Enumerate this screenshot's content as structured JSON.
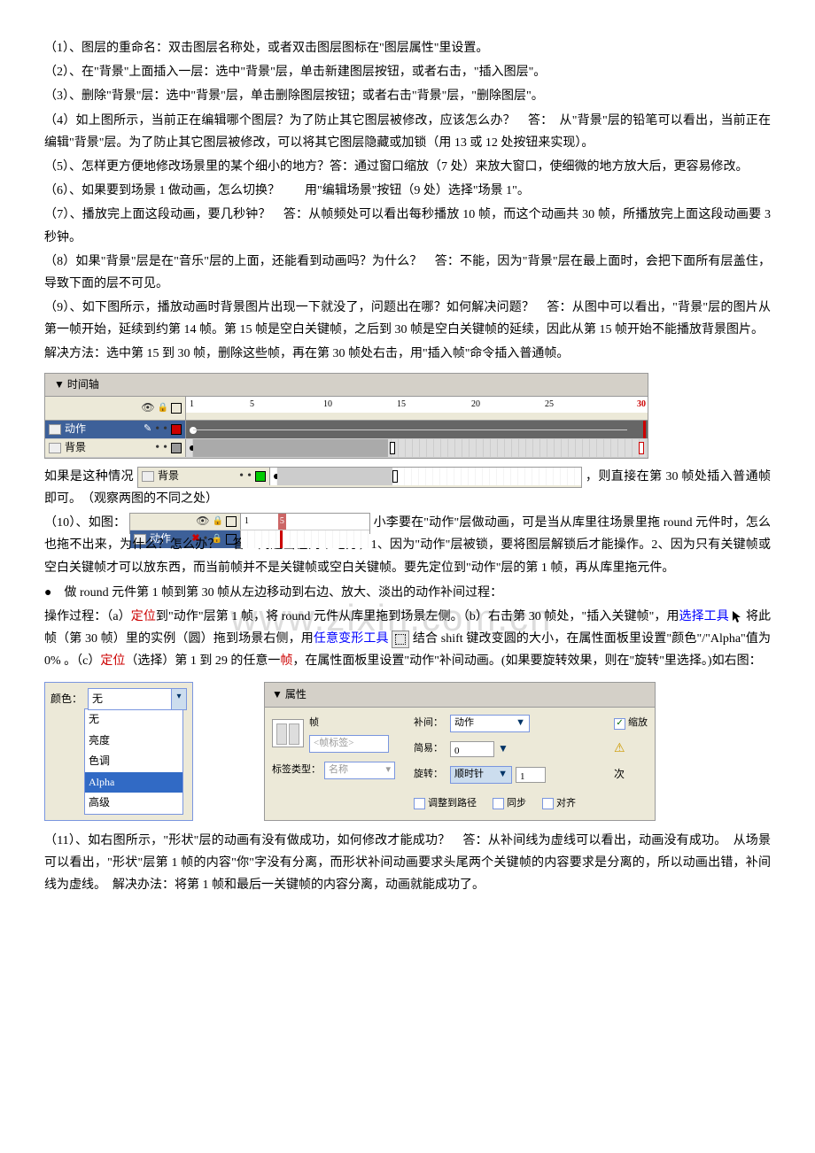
{
  "watermark": "www.zixin.com.cn",
  "paragraphs": {
    "p1_a": "（1）、图层的重命名：双击图层名称处，或者双击图层图标在\"图层属性\"里设置。",
    "p2": "（2）、在\"背景\"上面插入一层：选中\"背景\"层，单击新建图层按钮，或者右击，\"插入图层\"。",
    "p3": "（3）、删除\"背景\"层：选中\"背景\"层，单击删除图层按钮；或者右击\"背景\"层，\"删除图层\"。",
    "p4": "（4）如上图所示，当前正在编辑哪个图层？为了防止其它图层被修改，应该怎么办？　答：　从\"背景\"层的铅笔可以看出，当前正在编辑\"背景\"层。为了防止其它图层被修改，可以将其它图层隐藏或加锁（用 13 或 12 处按钮来实现）。",
    "p5": "（5）、怎样更方便地修改场景里的某个细小的地方？答：通过窗口缩放（7 处）来放大窗口，使细微的地方放大后，更容易修改。",
    "p6": "（6）、如果要到场景 1 做动画，怎么切换？　　用\"编辑场景\"按钮（9 处）选择\"场景 1\"。",
    "p7": "（7）、播放完上面这段动画，要几秒钟？　答：从帧频处可以看出每秒播放 10 帧，而这个动画共 30 帧，所播放完上面这段动画要 3 秒钟。",
    "p8": "（8）如果\"背景\"层是在\"音乐\"层的上面，还能看到动画吗？为什么？　答：不能，因为\"背景\"层在最上面时，会把下面所有层盖住，导致下面的层不可见。",
    "p9": "（9）、如下图所示，播放动画时背景图片出现一下就没了，问题出在哪？如何解决问题？　答：从图中可以看出，\"背景\"层的图片从第一帧开始，延续到约第 14 帧。第 15 帧是空白关键帧，之后到 30 帧是空白关键帧的延续，因此从第 15 帧开始不能播放背景图片。",
    "p9b": "解决方法：选中第 15 到 30 帧，删除这些帧，再在第 30 帧处右击，用\"插入帧\"命令插入普通帧。",
    "p9c_a": "如果是这种情况",
    "p9c_b": "，则直接在第 30 帧处插入普通帧即可。　（观察两图的不同之处）",
    "p10_a": "（10）、如图：",
    "p10_b": "小李要在\"动作\"层做动画，可是当从库里往场景里拖 round 元件时，怎么也拖不出来，为什么？怎么办？　答：问题出在两个地方，1、因为\"动作\"层被锁，要将图层解锁后才能操作。2、因为只有关键帧或空白关键帧才可以放东西，而当前帧并不是关键帧或空白关键帧。要先定位到\"动作\"层的第 1 帧，再从库里拖元件。",
    "bullet1": "做 round 元件第 1 帧到第 30 帧从左边移动到右边、放大、淡出的动作补间过程：",
    "op_a": "操作过程：（a）",
    "op_locate": "定位",
    "op_b": "到\"动作\"层第 1 帧，将 round 元件从库里拖到场景左侧。（b）右击第 30 帧处，\"插入关键帧\"，用",
    "op_select": "选择工具",
    "op_c": " 将此帧（第 30 帧）里的实例（圆）拖到场景右侧，用",
    "op_transform": "任意变形工具",
    "op_d": " 结合 shift 键改变圆的大小，在属性面板里设置\"颜色\"/\"Alpha\"值为 0% 。（c）",
    "op_locate2": "定位",
    "op_e": "（选择）第 1 到 29 的任意一",
    "op_frame": "帧",
    "op_f": "，在属性面板里设置\"动作\"补间动画。(如果要旋转效果，则在\"旋转\"里选择。)如右图：",
    "p11": "（11）、如右图所示，\"形状\"层的动画有没有做成功，如何修改才能成功？　答：从补间线为虚线可以看出，动画没有成功。　从场景可以看出，\"形状\"层第 1 帧的内容\"你\"字没有分离，而形状补间动画要求头尾两个关键帧的内容要求是分离的，所以动画出错，补间线为虚线。　解决办法：将第 1 帧和最后一关键帧的内容分离，动画就能成功了。"
  },
  "timeline1": {
    "tab": "▼ 时间轴",
    "ruler_nums": [
      "1",
      "5",
      "10",
      "15",
      "20",
      "25",
      "30"
    ],
    "layer1": "动作",
    "layer2": "背景"
  },
  "timeline_inline1": {
    "layer": "背景"
  },
  "timeline_inline2": {
    "layer": "动作",
    "ruler_nums": [
      "1",
      "5"
    ]
  },
  "color_panel": {
    "label": "颜色：",
    "selected": "无",
    "options": [
      "无",
      "亮度",
      "色调",
      "Alpha",
      "高级"
    ]
  },
  "prop_panel": {
    "title": "▼ 属性",
    "frame_label": "帧",
    "frame_placeholder": "<帧标签>",
    "label_type_label": "标签类型：",
    "label_type_value": "名称",
    "tween_label": "补间：",
    "tween_value": "动作",
    "scale_checkbox": "缩放",
    "ease_label": "简易：",
    "ease_value": "0",
    "rotate_label": "旋转：",
    "rotate_value": "顺时针",
    "rotate_count": "1",
    "rotate_unit": "次",
    "adjust_path": "调整到路径",
    "sync": "同步",
    "align": "对齐"
  }
}
